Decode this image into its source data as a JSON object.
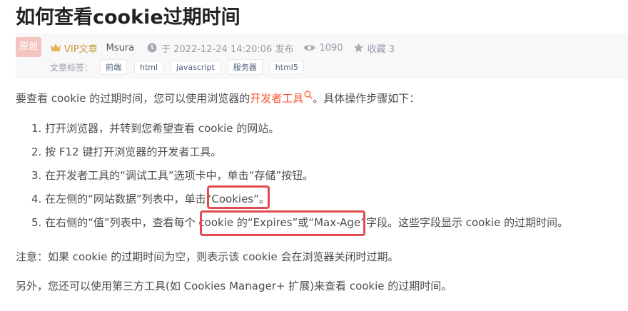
{
  "article": {
    "title": "如何查看cookie过期时间",
    "badge": "原创",
    "vip_label": "VIP文章",
    "author": "Msura",
    "publish_time": "于 2022-12-24 14:20:06 发布",
    "views": "1090",
    "favorites": "收藏 3",
    "tags_label": "文章标签：",
    "tags": [
      "前端",
      "html",
      "javascript",
      "服务器",
      "html5"
    ]
  },
  "content": {
    "intro_before": "要查看 cookie 的过期时间，您可以使用浏览器的",
    "intro_link": "开发者工具",
    "intro_after": "。具体操作步骤如下：",
    "steps": [
      "1. 打开浏览器，并转到您希望查看 cookie 的网站。",
      "2. 按 F12 键打开浏览器的开发者工具。",
      "3. 在开发者工具的“调试工具”选项卡中，单击“存储”按钮。",
      "4. 在左侧的“网站数据”列表中，单击“Cookies”。",
      "5. 在右侧的“值”列表中，查看每个 cookie 的“Expires”或“Max-Age”字段。这些字段显示 cookie 的过期时间。"
    ],
    "note": "注意：如果 cookie 的过期时间为空，则表示该 cookie 会在浏览器关闭时过期。",
    "note2": "另外，您还可以使用第三方工具(如 Cookies Manager+ 扩展)来查看 cookie 的过期时间。"
  },
  "colors": {
    "link": "#fc5531",
    "highlight_border": "#e24b4f",
    "vip": "#c89a3b"
  },
  "icons": {
    "vip": "crown-icon",
    "time": "clock-icon",
    "views": "eye-icon",
    "favorites": "star-icon",
    "link_search": "search-icon"
  }
}
